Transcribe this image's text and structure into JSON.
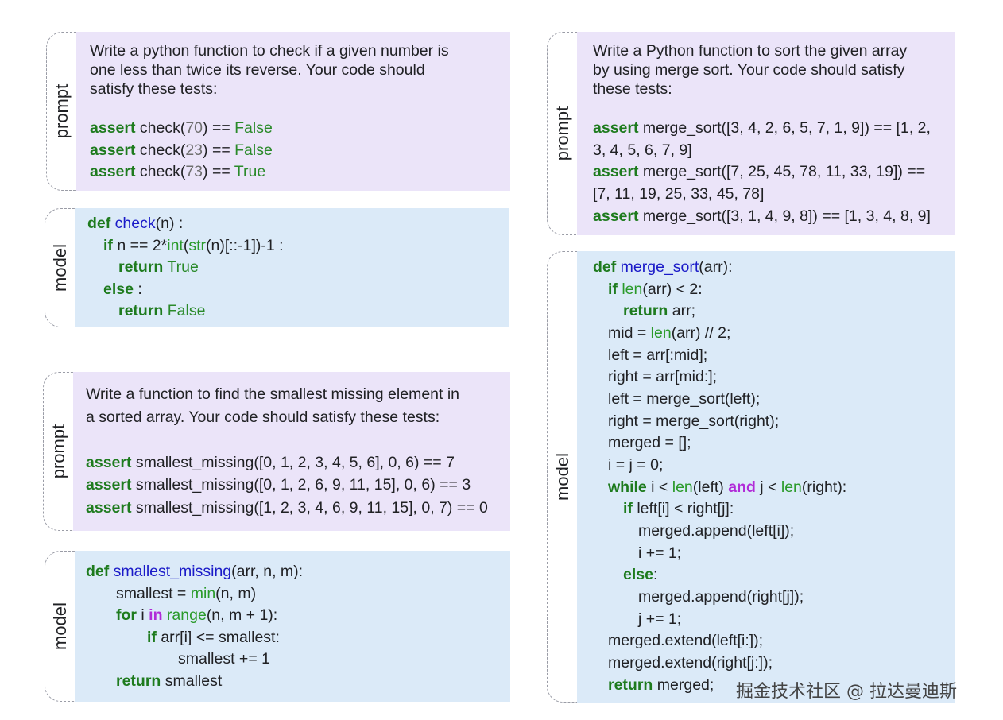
{
  "labels": {
    "prompt": "prompt",
    "model": "model"
  },
  "example1": {
    "prompt": {
      "text": [
        "Write a python function to check if a given number is",
        "one less than twice its reverse. Your code should",
        "satisfy these tests:"
      ],
      "tests": [
        {
          "kw": "assert",
          "call": "check(",
          "arg": "70",
          "close": ") ==",
          "result": "False"
        },
        {
          "kw": "assert",
          "call": "check(",
          "arg": "23",
          "close": ") ==",
          "result": "False"
        },
        {
          "kw": "assert",
          "call": "check(",
          "arg": "73",
          "close": ") ==",
          "result": "True"
        }
      ]
    },
    "model": {
      "l1": {
        "def": "def",
        "name": "check",
        "rest": "(n) :"
      },
      "l2": {
        "if": "if",
        "a": "n == 2*",
        "int": "int",
        "b": "(",
        "str": "str",
        "c": "(n)[::-1])-1 :"
      },
      "l3": {
        "ret": "return",
        "val": "True"
      },
      "l4": {
        "else": "else",
        "rest": " :"
      },
      "l5": {
        "ret": "return",
        "val": "False"
      }
    }
  },
  "example2": {
    "prompt": {
      "text": [
        "Write a function to find the smallest missing element in",
        "a sorted array. Your code should satisfy these tests:"
      ],
      "tests": [
        {
          "kw": "assert",
          "call": "smallest_missing(",
          "args": "[0, 1, 2, 3, 4, 5, 6], 0, 6) == 7"
        },
        {
          "kw": "assert",
          "call": "smallest_missing(",
          "args": "[0, 1, 2, 6, 9, 11, 15], 0, 6) == 3"
        },
        {
          "kw": "assert",
          "call": "smallest_missing(",
          "args": "[1, 2, 3, 4, 6, 9, 11, 15], 0, 7) == 0"
        }
      ]
    },
    "model": {
      "l1": {
        "def": "def",
        "name": "smallest_missing",
        "rest": "(arr, n, m):"
      },
      "l2": {
        "a": "smallest = ",
        "min": "min",
        "b": "(n, m)"
      },
      "l3": {
        "for": "for",
        "a": " i ",
        "in": "in",
        "range": " range",
        "b": "(n, m + 1):"
      },
      "l4": {
        "if": "if",
        "a": " arr[i] <= smallest:"
      },
      "l5": {
        "a": "smallest += 1"
      },
      "l6": {
        "ret": "return",
        "a": " smallest"
      }
    }
  },
  "example3": {
    "prompt": {
      "text": [
        "Write a Python function to sort the given array",
        "by using merge sort. Your code should satisfy",
        "these tests:"
      ],
      "tests": [
        {
          "kw": "assert",
          "a": " merge_sort([3, 4, 2, 6, 5, 7, 1, 9]) == [1, 2,",
          "b": "3, 4, 5, 6, 7, 9]"
        },
        {
          "kw": "assert",
          "a": " merge_sort([7, 25, 45, 78, 11, 33, 19]) ==",
          "b": "[7, 11, 19, 25, 33, 45, 78]"
        },
        {
          "kw": "assert",
          "a": " merge_sort([3, 1, 4, 9, 8]) == [1, 3, 4, 8, 9]"
        }
      ]
    },
    "model": {
      "l1": {
        "def": "def",
        "name": "merge_sort",
        "rest": "(arr):"
      },
      "l2": {
        "if": "if",
        "len": " len",
        "rest": "(arr) < 2:"
      },
      "l3": {
        "ret": "return",
        "rest": " arr;"
      },
      "l4": {
        "a": "mid = ",
        "len": "len",
        "b": "(arr) // 2;"
      },
      "l5": "left = arr[:mid];",
      "l6": "right = arr[mid:];",
      "l7": "left = merge_sort(left);",
      "l8": "right = merge_sort(right);",
      "l9": "merged = [];",
      "l10": "i = j = 0;",
      "l11": {
        "while": "while",
        "a": " i < ",
        "len1": "len",
        "b": "(left) ",
        "and": "and",
        "c": " j < ",
        "len2": "len",
        "d": "(right):"
      },
      "l12": {
        "if": "if",
        "a": " left[i] < right[j]:"
      },
      "l13": "merged.append(left[i]);",
      "l14": "i += 1;",
      "l15": {
        "else": "else",
        "a": ":"
      },
      "l16": "merged.append(right[j]);",
      "l17": "j += 1;",
      "l18": "merged.extend(left[i:]);",
      "l19": "merged.extend(right[j:]);",
      "l20": {
        "ret": "return",
        "a": " merged;"
      }
    }
  },
  "watermark": "掘金技术社区 @ 拉达曼迪斯",
  "colors": {
    "prompt_bg": "#ebe4f9",
    "model_bg": "#dbeaf8",
    "keyword": "#1e7b1e",
    "function": "#1a1ac8",
    "purple_keyword": "#b12bd8"
  }
}
